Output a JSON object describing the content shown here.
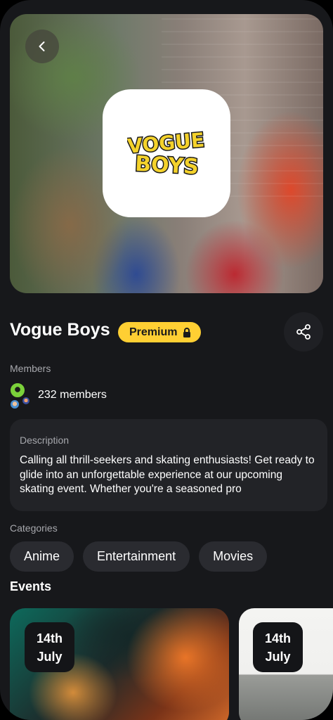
{
  "group": {
    "title": "Vogue Boys",
    "premium_label": "Premium",
    "logo_text": "VOGUE BOYS"
  },
  "members": {
    "label": "Members",
    "count_text": "232 members"
  },
  "description": {
    "label": "Description",
    "text": "Calling all thrill-seekers and skating enthusiasts! Get ready to glide into an unforgettable experience at our upcoming skating event. Whether you're a seasoned pro"
  },
  "categories": {
    "label": "Categories",
    "items": [
      "Anime",
      "Entertainment",
      "Movies"
    ]
  },
  "events": {
    "title": "Events",
    "items": [
      {
        "day": "14th",
        "month": "July"
      },
      {
        "day": "14th",
        "month": "July"
      }
    ]
  },
  "colors": {
    "background": "#17181b",
    "premium": "#ffcf33",
    "logo_yellow": "#f4d22b",
    "card": "#222327"
  },
  "icons": [
    "chevron-left-icon",
    "lock-icon",
    "share-icon"
  ]
}
